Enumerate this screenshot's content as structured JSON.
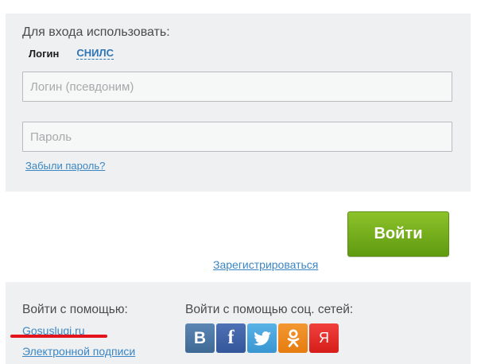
{
  "login_form": {
    "prompt": "Для входа использовать:",
    "tabs": {
      "login": "Логин",
      "snils": "СНИЛС"
    },
    "login_placeholder": "Логин (псевдоним)",
    "password_placeholder": "Пароль",
    "forgot_password": "Забыли пароль?"
  },
  "actions": {
    "submit": "Войти",
    "register": "Зарегистрироваться"
  },
  "alternatives": {
    "heading_methods": "Войти с помощью:",
    "heading_social": "Войти с помощью соц. сетей:",
    "gosuslugi": "Gosuslugi.ru",
    "electronic_signature": "Электронной подписи",
    "social": [
      {
        "label": "B",
        "icon": "vk-icon",
        "color": "#4a76a8"
      },
      {
        "label": "f",
        "icon": "facebook-icon",
        "color": "#3b5998"
      },
      {
        "label": "",
        "icon": "twitter-icon",
        "color": "#4aa8e0"
      },
      {
        "label": "",
        "icon": "odnoklassniki-icon",
        "color": "#ee8208"
      },
      {
        "label": "Я",
        "icon": "yandex-icon",
        "color": "#e8271f"
      }
    ]
  }
}
